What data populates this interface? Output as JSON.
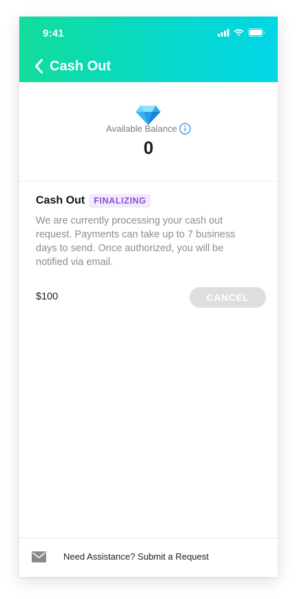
{
  "status_bar": {
    "time": "9:41",
    "icons": [
      "cellular-signal-icon",
      "wifi-icon",
      "battery-icon"
    ]
  },
  "header": {
    "back_icon": "chevron-left-icon",
    "title": "Cash Out",
    "gradient_colors": [
      "#12dd9a",
      "#02d6e6"
    ]
  },
  "balance": {
    "icon": "diamond-icon",
    "label": "Available Balance",
    "info_icon": "info-icon",
    "value": "0"
  },
  "cashout_request": {
    "title": "Cash Out",
    "status_badge": "FINALIZING",
    "description": "We are currently processing your cash out request. Payments can take up to 7 business days to send. Once authorized, you will be notified via email.",
    "amount": "$100",
    "cancel_label": "CANCEL"
  },
  "footer": {
    "icon": "mail-icon",
    "link_text": "Need Assistance? Submit a Request"
  },
  "colors": {
    "badge_text": "#8a4fe0",
    "badge_bg": "#f1ebfb",
    "cancel_bg": "#dedede",
    "info_blue": "#2d8ce8"
  }
}
